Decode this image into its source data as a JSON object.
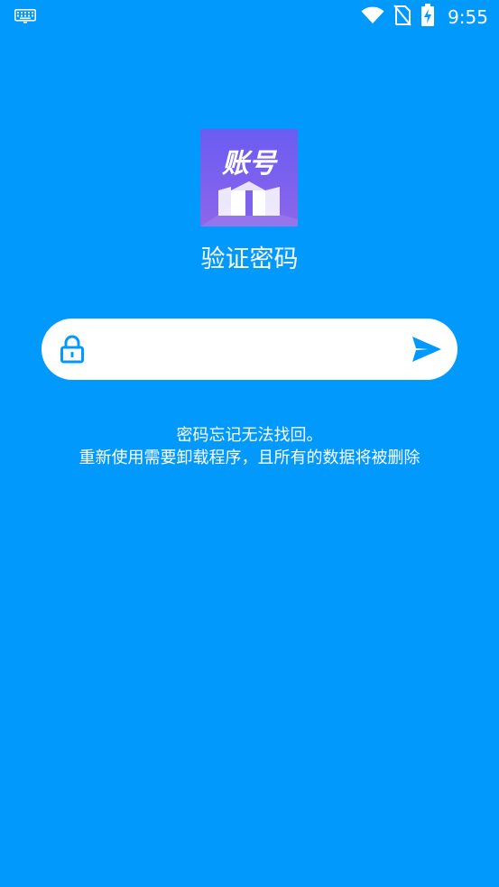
{
  "status_bar": {
    "time": "9:55",
    "icons": [
      "keyboard-icon",
      "wifi-icon",
      "no-sim-icon",
      "battery-charging-icon"
    ]
  },
  "app_logo": {
    "text": "账号",
    "gradient_top": "#6f5cf1",
    "gradient_bottom": "#8a63e8"
  },
  "page": {
    "title": "验证密码"
  },
  "password_field": {
    "value": "",
    "placeholder": "",
    "icon": "lock-icon",
    "submit_icon": "send-icon"
  },
  "hint": {
    "line1": "密码忘记无法找回。",
    "line2": "重新使用需要卸载程序，且所有的数据将被删除"
  },
  "colors": {
    "background": "#0299fd",
    "accent": "#0299fd",
    "field_background": "#ffffff"
  }
}
